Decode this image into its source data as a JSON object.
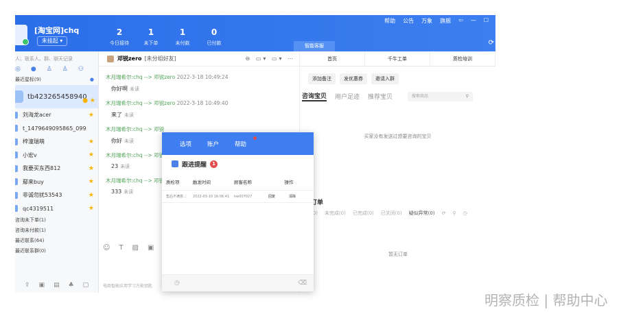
{
  "topbar": {
    "title": "[淘宝网]chq",
    "login_status": "未挂起 ▾",
    "stats": [
      {
        "value": "2",
        "label": "今日接待"
      },
      {
        "value": "1",
        "label": "未下单"
      },
      {
        "value": "1",
        "label": "未付款"
      },
      {
        "value": "0",
        "label": "已付款"
      }
    ],
    "menu": [
      "帮助",
      "公告",
      "万象",
      "旗舰",
      "⇦",
      "—",
      "☐"
    ],
    "assistant_tab": "智能客服"
  },
  "sidebar": {
    "search_placeholder": "人、联系人、群、聊天记录",
    "recent_group": "最近星标(9)",
    "active_contact": "tb423265458940",
    "contacts": [
      "刘海龙acer",
      "t_1479649095865_099",
      "梓潼瑞萌",
      "小宏v",
      "我要买东西812",
      "鄢来buy",
      "非诚勿扰53543",
      "qc4319511"
    ],
    "sections": [
      "咨询未下单(1)",
      "咨询未付款(1)",
      "最近联系(64)",
      "最近联系群(0)"
    ]
  },
  "chat": {
    "contact_name": "邓锐zero",
    "contact_group": "[未分组好友]",
    "messages": [
      {
        "sender": "木月瑞希尔:chq --> 邓锐zero",
        "time": "2022-3-18 10:49:24",
        "text": "你好啊",
        "status": "未读"
      },
      {
        "sender": "木月瑞希尔:chq --> 邓锐zero",
        "time": "2022-3-18 10:49:40",
        "text": "来了",
        "status": "未读"
      },
      {
        "sender": "木月瑞希尔:chq --> 邓锐",
        "time": "",
        "text": "你好",
        "status": "未读"
      },
      {
        "sender": "木月瑞希尔:chq --> 邓锐",
        "time": "",
        "text": "23",
        "status": "未读"
      },
      {
        "sender": "木月瑞希尔:chq --> 邓锐",
        "time": "",
        "text": "333",
        "status": "未读"
      }
    ],
    "footer": "电商智能应用学习万能钥匙"
  },
  "right_panel": {
    "tabs": [
      "首页",
      "千牛工单",
      "质检培训"
    ],
    "buttons": [
      "添加备注",
      "发优惠券",
      "邀请入群"
    ],
    "subtabs": [
      "咨询宝贝",
      "用户足迹",
      "推荐宝贝"
    ],
    "search_placeholder": "搜索商品",
    "empty_text": "买家没有发送过想要咨询的宝贝",
    "orders_title": "订单",
    "filters": [
      "(0)",
      "未完成(0)",
      "已完成(0)",
      "已关闭(0)",
      "疑似异常(0)"
    ],
    "no_orders": "暂无订单"
  },
  "dialog": {
    "menu": [
      "选项",
      "账户",
      "帮助"
    ],
    "title": "跟进提醒",
    "badge": "1",
    "columns": [
      "质检项",
      "触发时间",
      "顾客名称",
      "操作"
    ],
    "rows": [
      {
        "item": "售后不满意...",
        "time": "2022-03-10 16:06:41",
        "customer": "hw007027",
        "reply": "回复",
        "clear": "清除"
      }
    ]
  },
  "watermark": "明察质检 | 帮助中心"
}
